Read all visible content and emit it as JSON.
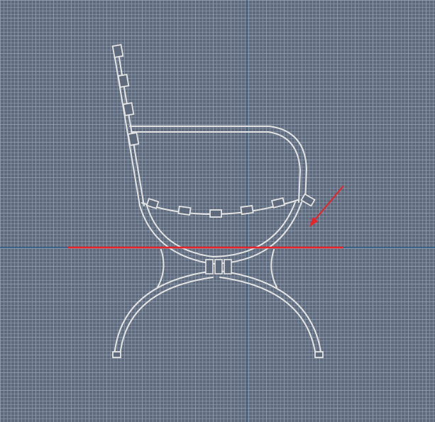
{
  "viewport": {
    "name": "cad-viewport",
    "background_color": "#5f6b7c",
    "grid_color": "#96a5b9",
    "axis_color": "#2f5f86"
  },
  "model": {
    "name": "garden-bench-side-profile",
    "stroke_color": "#e4e4e4"
  },
  "annotations": {
    "reference_line_color": "#e8232a",
    "arrow_color": "#e8232a"
  }
}
